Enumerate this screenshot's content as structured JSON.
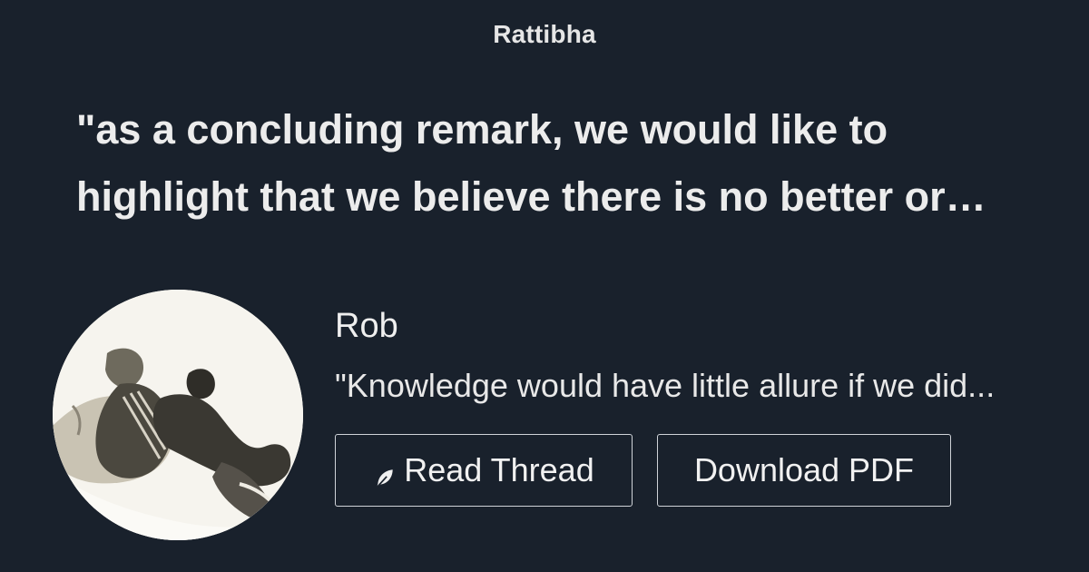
{
  "brand": "Rattibha",
  "headline": "\"as a concluding remark, we would like to highlight that we believe there is no better or…",
  "author": {
    "name": "Rob",
    "bio": "\"Knowledge would have little allure if we did..."
  },
  "actions": {
    "read_thread": "Read Thread",
    "download_pdf": "Download PDF"
  },
  "icons": {
    "read_thread": "feather-icon"
  },
  "colors": {
    "background": "#19212c",
    "text": "#ececec",
    "button_border": "#cfd3d8"
  }
}
